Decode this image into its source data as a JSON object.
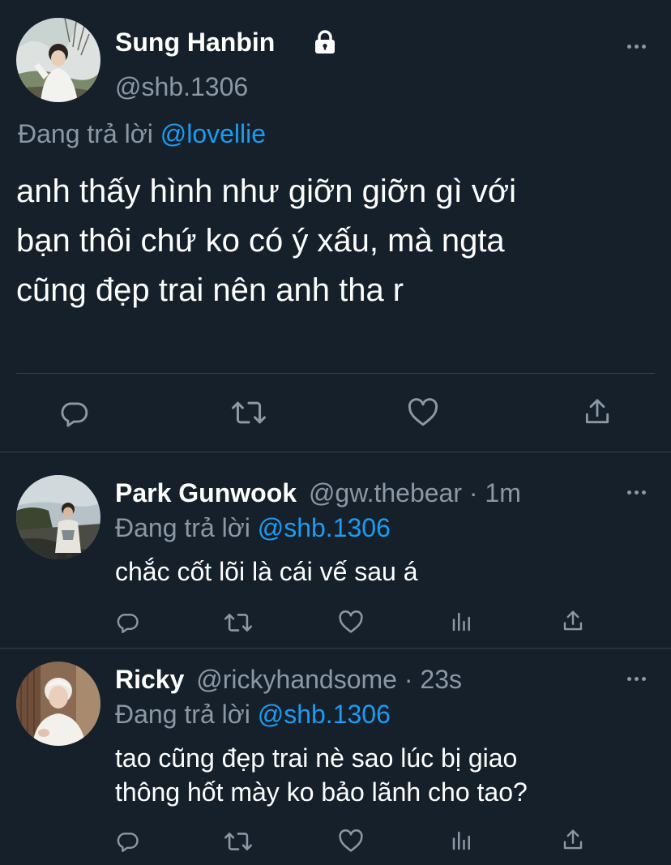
{
  "main_tweet": {
    "display_name": "Sung Hanbin",
    "handle": "@shb.1306",
    "replying_prefix": "Đang trả lời",
    "replying_to": "@lovellie",
    "text_lines": [
      "anh thấy hình như giỡn giỡn gì với",
      "bạn thôi chứ ko có ý xấu, mà ngta",
      "cũng đẹp trai nên anh tha r"
    ],
    "icons": [
      "lock-icon",
      "more-icon",
      "reply-icon",
      "retweet-icon",
      "like-icon",
      "share-icon"
    ]
  },
  "replies": [
    {
      "display_name": "Park Gunwook",
      "handle": "@gw.thebear",
      "time": "· 1m",
      "replying_prefix": "Đang trả lời",
      "replying_to": "@shb.1306",
      "text_lines": [
        "chắc cốt lõi là cái vế sau á"
      ]
    },
    {
      "display_name": "Ricky",
      "handle": "@rickyhandsome",
      "time": "· 23s",
      "replying_prefix": "Đang trả lời",
      "replying_to": "@shb.1306",
      "text_lines": [
        "tao cũng đẹp trai nè sao lúc bị giao",
        "thông hốt mày ko bảo lãnh cho tao?"
      ]
    }
  ],
  "colors": {
    "background": "#15202b",
    "text": "#ffffff",
    "secondary": "#8b98a5",
    "link": "#1d9bf0",
    "divider": "#38444d"
  }
}
